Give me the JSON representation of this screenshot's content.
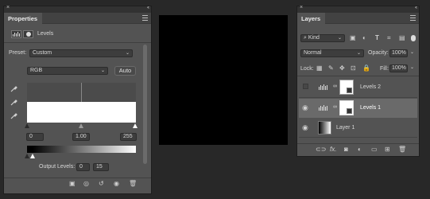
{
  "properties": {
    "tab_title": "Properties",
    "adjustment_label": "Levels",
    "preset_label": "Preset:",
    "preset_value": "Custom",
    "channel_value": "RGB",
    "auto_label": "Auto",
    "input_black": "0",
    "input_gamma": "1.00",
    "input_white": "255",
    "output_label": "Output Levels:",
    "output_black": "0",
    "output_white": "15"
  },
  "layers": {
    "tab_title": "Layers",
    "filter_kind": "Kind",
    "blend_mode": "Normal",
    "opacity_label": "Opacity:",
    "opacity_value": "100%",
    "lock_label": "Lock:",
    "fill_label": "Fill:",
    "fill_value": "100%",
    "items": [
      {
        "name": "Levels 2",
        "visible": false,
        "selected": false
      },
      {
        "name": "Levels 1",
        "visible": true,
        "selected": true
      },
      {
        "name": "Layer 1",
        "visible": true,
        "selected": false
      }
    ]
  },
  "colors": {
    "panel_bg": "#535353",
    "selected_row": "#6a6a6a",
    "app_bg": "#282828"
  }
}
